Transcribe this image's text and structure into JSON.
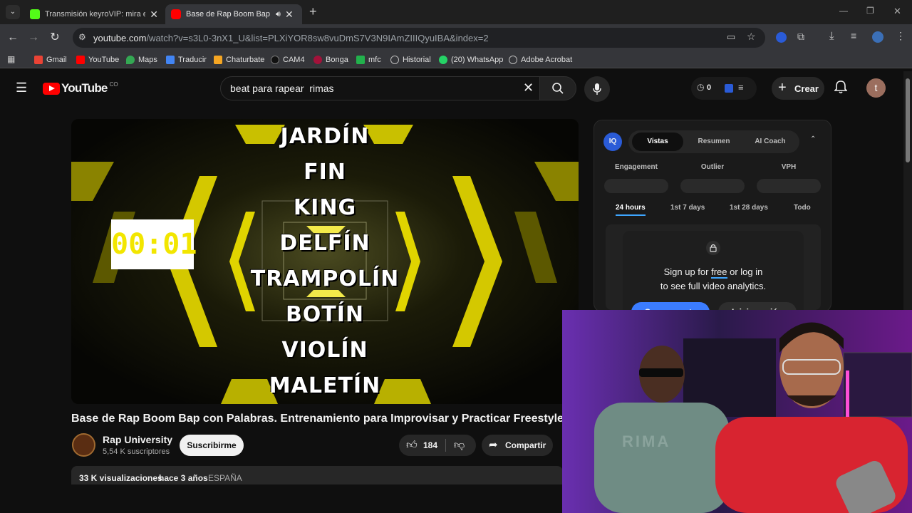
{
  "browser": {
    "tabs": [
      {
        "title": "Transmisión keyroVIP: mira en vivo",
        "close": "✕"
      },
      {
        "title": "Base de Rap Boom Bap con Palabras",
        "close": "✕"
      }
    ],
    "new_tab": "+",
    "url_host": "youtube.com",
    "url_path": "/watch?v=s3L0-3nX1_U&list=PLXiYOR8sw8vuDmS7V3N9IAmZIIIQyuIBA&index=2",
    "window_controls": [
      "—",
      "❐",
      "✕"
    ]
  },
  "bookmarks": [
    {
      "label": "Gmail",
      "color": "#ea4335"
    },
    {
      "label": "YouTube",
      "color": "#ff0000"
    },
    {
      "label": "Maps",
      "color": "#34a853"
    },
    {
      "label": "Traducir",
      "color": "#4285f4"
    },
    {
      "label": "Chaturbate",
      "color": "#f5a623"
    },
    {
      "label": "CAM4",
      "color": "#111111"
    },
    {
      "label": "Bonga",
      "color": "#a3123a"
    },
    {
      "label": "mfc",
      "color": "#22b14c"
    },
    {
      "label": "Historial",
      "color": "#9aa0a6"
    },
    {
      "label": "(20) WhatsApp",
      "color": "#25d366"
    },
    {
      "label": "Adobe Acrobat",
      "color": "#9aa0a6"
    }
  ],
  "youtube": {
    "logo": "YouTube",
    "country": "CO",
    "search_query": "beat para rapear  rimas",
    "bell_count": "0",
    "create_label": "Crear",
    "avatar_letter": "t"
  },
  "video": {
    "words": [
      "JARDÍN",
      "FIN",
      "KING",
      "DELFÍN",
      "TRAMPOLÍN",
      "BOTÍN",
      "VIOLÍN",
      "MALETÍN"
    ],
    "timer": "00:01",
    "title": "Base de Rap Boom Bap con Palabras. Entrenamiento para Improvisar y Practicar Freestyle.",
    "channel": "Rap University",
    "subscribers": "5,54 K suscriptores",
    "subscribe_label": "Suscribirme",
    "likes": "184",
    "share_label": "Compartir",
    "views": "33 K visualizaciones",
    "age": "hace 3 años",
    "country_tag": "ESPAÑA"
  },
  "analytics": {
    "logo": "IQ",
    "tabs": [
      "Vistas",
      "Resumen",
      "AI Coach"
    ],
    "metrics": [
      "Engagement",
      "Outlier",
      "VPH"
    ],
    "ranges": [
      "24 hours",
      "1st 7 days",
      "1st 28 days",
      "Todo"
    ],
    "lock_line1_a": "Sign up for ",
    "lock_line1_free": "free",
    "lock_line1_b": " or log in",
    "lock_line2": "to see full video analytics.",
    "create_account": "Crear cuenta",
    "login": "Inicia sesión"
  },
  "webcam": {
    "hoodie_text": "RIMA"
  }
}
